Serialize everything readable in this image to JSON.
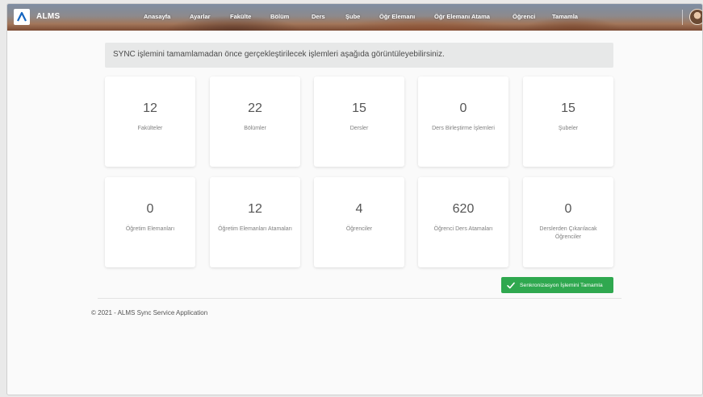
{
  "app": {
    "name": "ALMS"
  },
  "nav": {
    "items": [
      {
        "label": "Anasayfa"
      },
      {
        "label": "Ayarlar"
      },
      {
        "label": "Fakülte"
      },
      {
        "label": "Bölüm"
      },
      {
        "label": "Ders"
      },
      {
        "label": "Şube"
      },
      {
        "label": "Öğr Elemanı"
      },
      {
        "label": "Öğr Elemanı Atama"
      },
      {
        "label": "Öğrenci"
      },
      {
        "label": "Tamamla"
      }
    ]
  },
  "banner": {
    "text": "SYNC işlemini tamamlamadan önce gerçekleştirilecek işlemleri aşağıda görüntüleyebilirsiniz."
  },
  "stats": [
    {
      "value": "12",
      "label": "Fakülteler"
    },
    {
      "value": "22",
      "label": "Bölümler"
    },
    {
      "value": "15",
      "label": "Dersler"
    },
    {
      "value": "0",
      "label": "Ders Birleştirme İşlemleri"
    },
    {
      "value": "15",
      "label": "Şubeler"
    },
    {
      "value": "0",
      "label": "Öğretim Elemanları"
    },
    {
      "value": "12",
      "label": "Öğretim Elemanları Atamaları"
    },
    {
      "value": "4",
      "label": "Öğrenciler"
    },
    {
      "value": "620",
      "label": "Öğrenci Ders Atamaları"
    },
    {
      "value": "0",
      "label": "Derslerden Çıkarılacak Öğrenciler"
    }
  ],
  "sync_button": {
    "label": "Senkronizasyon İşlemini Tamamla",
    "icon": "check-icon"
  },
  "footer": {
    "text": "© 2021 - ALMS Sync Service Application"
  },
  "colors": {
    "accent_green": "#2fa84f",
    "brand_blue": "#1565c0"
  }
}
